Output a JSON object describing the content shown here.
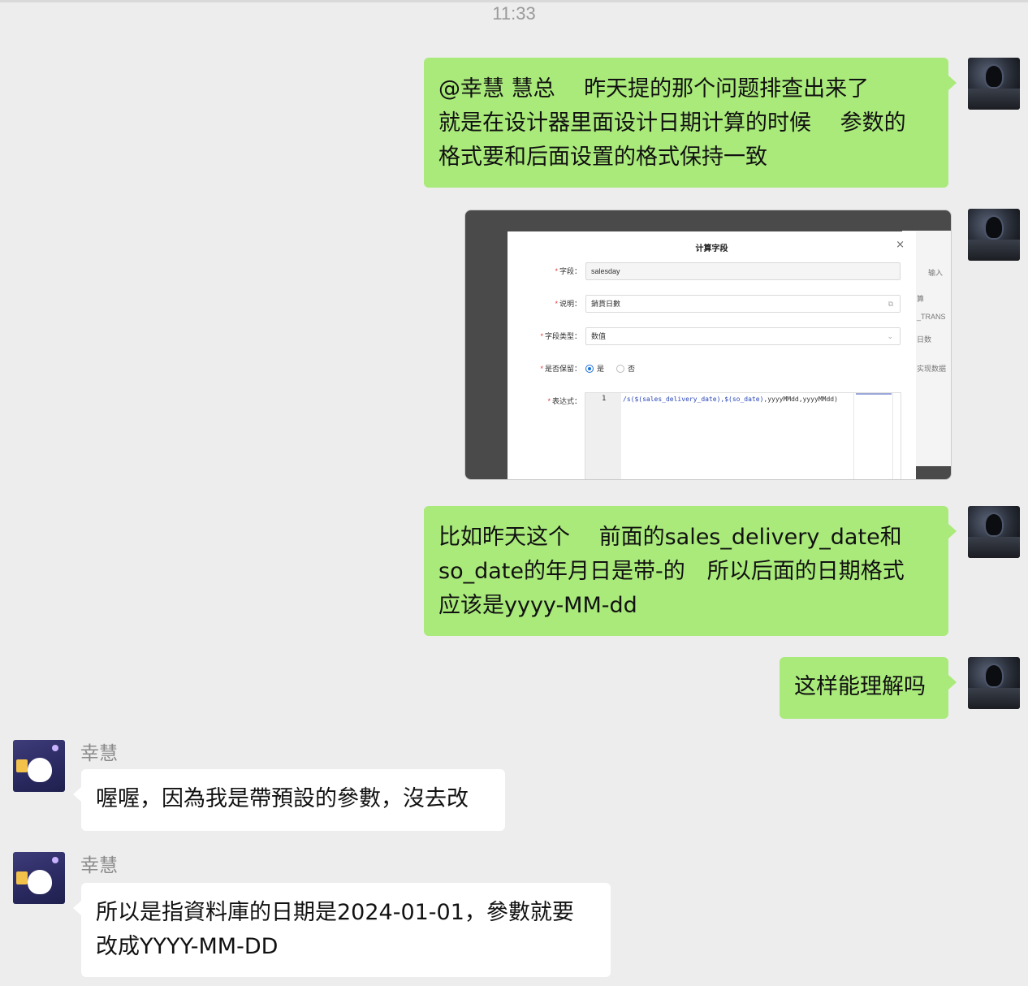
{
  "timestamp": "11:33",
  "messages": {
    "m1": {
      "lines": [
        "@幸慧 慧总　 昨天提的那个问题排查出来了",
        "就是在设计器里面设计日期计算的时候　 参数的",
        "格式要和后面设置的格式保持一致"
      ]
    },
    "m3": {
      "lines": [
        "比如昨天这个　 前面的sales_delivery_date和",
        " so_date的年月日是带-的　所以后面的日期格式",
        "应该是yyyy-MM-dd"
      ]
    },
    "m4": {
      "text": "这样能理解吗"
    },
    "m5": {
      "sender": "幸慧",
      "text": "喔喔，因為我是帶預設的參數，沒去改"
    },
    "m6": {
      "sender": "幸慧",
      "lines": [
        "所以是指資料庫的日期是2024-01-01，參數就要",
        "改成YYYY-MM-DD"
      ]
    }
  },
  "screenshot": {
    "dialog_title": "计算字段",
    "close": "×",
    "required_mark": "*",
    "fields": {
      "field": {
        "label": "字段：",
        "value": "salesday"
      },
      "desc": {
        "label": "说明：",
        "value": "銷貨日數"
      },
      "type": {
        "label": "字段类型：",
        "value": "数值",
        "suffix": "⌄"
      },
      "keep": {
        "label": "是否保留：",
        "yes": "是",
        "no": "否",
        "selected": "是"
      },
      "expr": {
        "label": "表达式：",
        "line_number": "1",
        "code_fn": "/s($(sales_delivery_date),$(so_date),",
        "code_rest": "yyyyMMdd,yyyyMMdd)"
      }
    },
    "background_text": [
      "输入",
      "算",
      "_TRANS",
      "日数",
      "实现数据"
    ]
  }
}
